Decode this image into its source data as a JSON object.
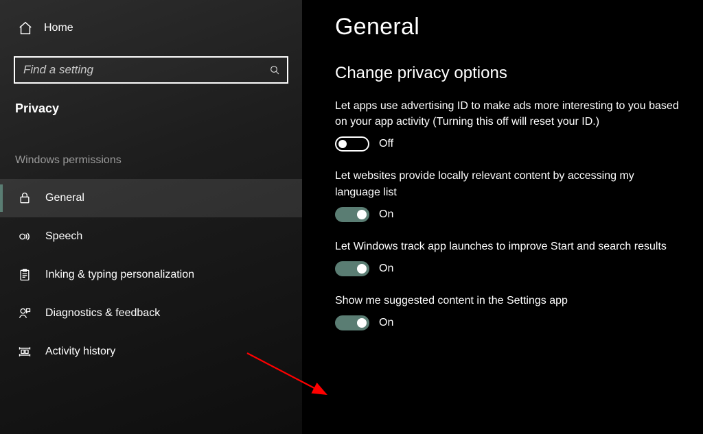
{
  "sidebar": {
    "home_label": "Home",
    "search_placeholder": "Find a setting",
    "category": "Privacy",
    "group_label": "Windows permissions",
    "items": [
      {
        "label": "General"
      },
      {
        "label": "Speech"
      },
      {
        "label": "Inking & typing personalization"
      },
      {
        "label": "Diagnostics & feedback"
      },
      {
        "label": "Activity history"
      }
    ]
  },
  "main": {
    "title": "General",
    "section_title": "Change privacy options",
    "settings": [
      {
        "desc": "Let apps use advertising ID to make ads more interesting to you based on your app activity (Turning this off will reset your ID.)",
        "state_label": "Off",
        "on": false
      },
      {
        "desc": "Let websites provide locally relevant content by accessing my language list",
        "state_label": "On",
        "on": true
      },
      {
        "desc": "Let Windows track app launches to improve Start and search results",
        "state_label": "On",
        "on": true
      },
      {
        "desc": "Show me suggested content in the Settings app",
        "state_label": "On",
        "on": true
      }
    ]
  },
  "colors": {
    "accent": "#5a7d73",
    "arrow": "#ff0000"
  }
}
